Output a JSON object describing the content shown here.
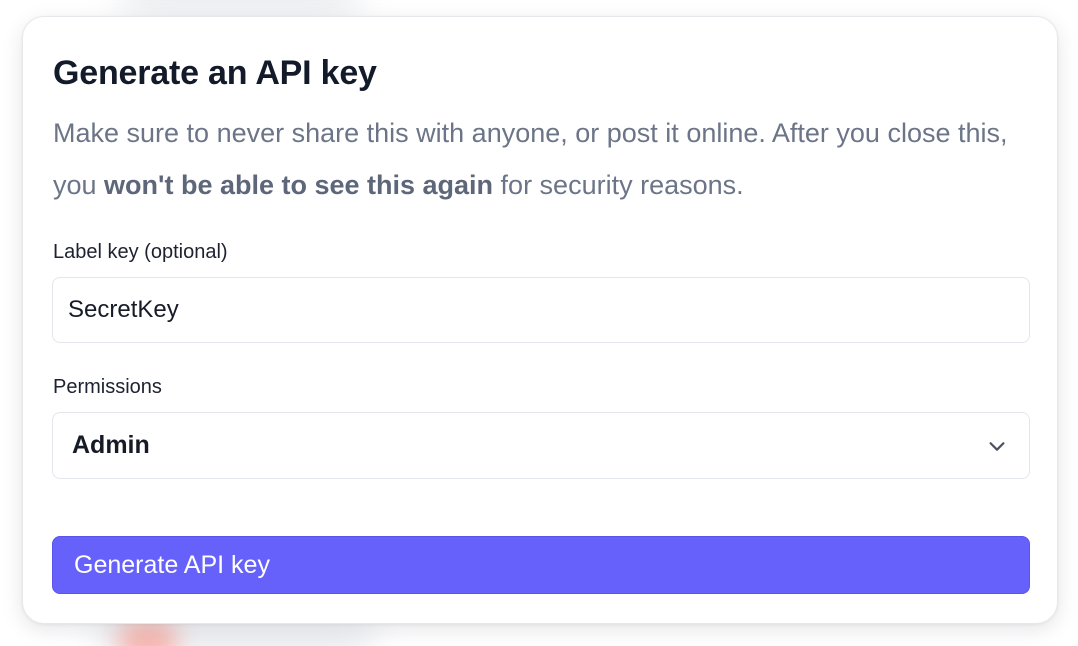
{
  "modal": {
    "title": "Generate an API key",
    "description": {
      "part1": "Make sure to never share this with anyone, or post it online. After you close this, you ",
      "emphasis": "won't be able to see this again",
      "part2": " for security reasons."
    },
    "label_key": {
      "label": "Label key (optional)",
      "value": "SecretKey"
    },
    "permissions": {
      "label": "Permissions",
      "selected": "Admin"
    },
    "submit_label": "Generate API key"
  },
  "colors": {
    "primary": "#6761fb",
    "title": "#131a2a",
    "muted_text": "#6b7587",
    "border": "#e3e6ea"
  },
  "icons": {
    "permissions_dropdown": "chevron-down-icon"
  }
}
